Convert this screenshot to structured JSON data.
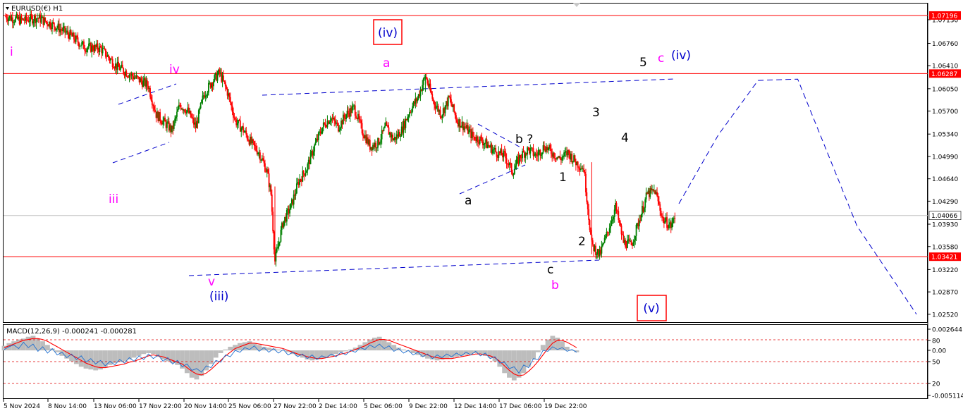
{
  "header": {
    "symbol_label": "EURUSD(€) H1"
  },
  "chart_data": {
    "type": "candlestick",
    "symbol": "EURUSD(€)",
    "timeframe": "H1",
    "y_ticks": [
      "1.07130",
      "1.06760",
      "1.06410",
      "1.06050",
      "1.05700",
      "1.05340",
      "1.04990",
      "1.04640",
      "1.04290",
      "1.03930",
      "1.03580",
      "1.03220",
      "1.02870",
      "1.02520"
    ],
    "x_ticks": [
      "5 Nov 2024",
      "8 Nov 14:00",
      "13 Nov 06:00",
      "17 Nov 22:00",
      "20 Nov 14:00",
      "25 Nov 06:00",
      "27 Nov 22:00",
      "2 Dec 14:00",
      "5 Dec 06:00",
      "9 Dec 22:00",
      "12 Dec 14:00",
      "17 Dec 06:00",
      "19 Dec 22:00"
    ],
    "ylim": [
      1.0243,
      1.0735
    ],
    "horizontal_levels": [
      {
        "value": 1.07196,
        "label": "1.07196",
        "color": "#ff0000"
      },
      {
        "value": 1.06287,
        "label": "1.06287",
        "color": "#ff0000"
      },
      {
        "value": 1.03421,
        "label": "1.03421",
        "color": "#ff0000"
      },
      {
        "value": 1.04066,
        "label": "1.04066",
        "color": "#c0c0c0",
        "current_price": true
      }
    ],
    "wave_labels": {
      "magenta": [
        "i",
        "iii",
        "iv",
        "v",
        "a",
        "b",
        "c"
      ],
      "black": [
        "1",
        "2",
        "3",
        "4",
        "5",
        "a",
        "b ?",
        "c"
      ],
      "blue": [
        "(iii)",
        "(iv)"
      ],
      "boxed": [
        "(iv)",
        "(v)"
      ]
    },
    "price_path": [
      [
        0,
        1.0718
      ],
      [
        4,
        1.0712
      ],
      [
        8,
        1.0716
      ],
      [
        12,
        1.0705
      ],
      [
        16,
        1.069
      ],
      [
        20,
        1.067
      ],
      [
        24,
        1.0668
      ],
      [
        28,
        1.064
      ],
      [
        32,
        1.0625
      ],
      [
        36,
        1.061
      ],
      [
        38,
        1.0565
      ],
      [
        42,
        1.054
      ],
      [
        44,
        1.058
      ],
      [
        46,
        1.057
      ],
      [
        48,
        1.0545
      ],
      [
        50,
        1.0595
      ],
      [
        52,
        1.0615
      ],
      [
        54,
        1.063
      ],
      [
        56,
        1.06
      ],
      [
        58,
        1.0555
      ],
      [
        60,
        1.054
      ],
      [
        62,
        1.052
      ],
      [
        64,
        1.0505
      ],
      [
        66,
        1.0475
      ],
      [
        67,
        1.044
      ],
      [
        68,
        1.0335
      ],
      [
        70,
        1.0395
      ],
      [
        72,
        1.042
      ],
      [
        74,
        1.046
      ],
      [
        76,
        1.048
      ],
      [
        78,
        1.0515
      ],
      [
        80,
        1.0545
      ],
      [
        82,
        1.056
      ],
      [
        84,
        1.0545
      ],
      [
        86,
        1.0565
      ],
      [
        88,
        1.0575
      ],
      [
        90,
        1.054
      ],
      [
        92,
        1.0515
      ],
      [
        94,
        1.052
      ],
      [
        96,
        1.0545
      ],
      [
        98,
        1.0525
      ],
      [
        100,
        1.054
      ],
      [
        102,
        1.057
      ],
      [
        104,
        1.059
      ],
      [
        106,
        1.0625
      ],
      [
        108,
        1.0585
      ],
      [
        110,
        1.0565
      ],
      [
        112,
        1.059
      ],
      [
        114,
        1.0555
      ],
      [
        116,
        1.0545
      ],
      [
        118,
        1.053
      ],
      [
        120,
        1.0525
      ],
      [
        122,
        1.0515
      ],
      [
        124,
        1.0505
      ],
      [
        126,
        1.05
      ],
      [
        128,
        1.0475
      ],
      [
        130,
        1.05
      ],
      [
        132,
        1.051
      ],
      [
        134,
        1.05
      ],
      [
        136,
        1.0515
      ],
      [
        138,
        1.0505
      ],
      [
        140,
        1.0495
      ],
      [
        142,
        1.0505
      ],
      [
        144,
        1.049
      ],
      [
        146,
        1.048
      ],
      [
        148,
        1.036
      ],
      [
        150,
        1.0345
      ],
      [
        152,
        1.038
      ],
      [
        154,
        1.042
      ],
      [
        156,
        1.0365
      ],
      [
        158,
        1.036
      ],
      [
        160,
        1.04
      ],
      [
        162,
        1.044
      ],
      [
        164,
        1.0445
      ],
      [
        166,
        1.04
      ],
      [
        168,
        1.039
      ],
      [
        169,
        1.0405
      ]
    ],
    "projection": [
      [
        170,
        1.0425
      ],
      [
        180,
        1.0533
      ],
      [
        190,
        1.0618
      ],
      [
        200,
        1.062
      ],
      [
        215,
        1.039
      ],
      [
        230,
        1.0252
      ]
    ],
    "macd": {
      "label": "MACD(12,26,9) -0.000241 -0.000281",
      "y_ticks": [
        "0.002644",
        "80",
        "0.00",
        "50",
        "20",
        "-0.005114"
      ],
      "histogram": [
        0.0005,
        0.0008,
        0.001,
        0.0012,
        0.0013,
        0.0015,
        0.0016,
        0.0013,
        0.001,
        0.0006,
        0.0002,
        -0.0002,
        -0.0006,
        -0.0009,
        -0.0012,
        -0.0015,
        -0.0018,
        -0.002,
        -0.0021,
        -0.0022,
        -0.0021,
        -0.0019,
        -0.0016,
        -0.0014,
        -0.0013,
        -0.0012,
        -0.001,
        -0.0008,
        -0.0006,
        -0.0004,
        -0.0003,
        -0.0004,
        -0.0007,
        -0.001,
        -0.0012,
        -0.0014,
        -0.0016,
        -0.002,
        -0.0025,
        -0.003,
        -0.0032,
        -0.0028,
        -0.0022,
        -0.0015,
        -0.0008,
        -0.0003,
        0.0001,
        0.0004,
        0.0006,
        0.0008,
        0.0009,
        0.001,
        0.0008,
        0.0006,
        0.0004,
        0.0003,
        0.0002,
        0.0001,
        0.0,
        -0.0002,
        -0.0004,
        -0.0006,
        -0.0008,
        -0.001,
        -0.0011,
        -0.001,
        -0.0009,
        -0.0008,
        -0.0006,
        -0.0004,
        -0.0002,
        -0.0001,
        0.0001,
        0.0003,
        0.0006,
        0.0009,
        0.0012,
        0.0014,
        0.0015,
        0.0012,
        0.0009,
        0.0006,
        0.0003,
        0.0001,
        -0.0001,
        -0.0003,
        -0.0005,
        -0.0007,
        -0.0009,
        -0.001,
        -0.0011,
        -0.001,
        -0.0009,
        -0.0008,
        -0.0007,
        -0.0006,
        -0.0005,
        -0.0004,
        -0.0003,
        -0.0004,
        -0.0006,
        -0.0008,
        -0.0012,
        -0.0018,
        -0.0025,
        -0.003,
        -0.0033,
        -0.003,
        -0.0025,
        -0.0018,
        -0.001,
        -0.0002,
        0.0006,
        0.0012,
        0.0016,
        0.0014,
        0.001,
        0.0004,
        0.0,
        -0.0002
      ],
      "signal": [
        0.0003,
        0.0005,
        0.0007,
        0.0009,
        0.0011,
        0.0012,
        0.0013,
        0.0013,
        0.0012,
        0.001,
        0.0007,
        0.0004,
        0.0001,
        -0.0002,
        -0.0005,
        -0.0008,
        -0.0011,
        -0.0014,
        -0.0016,
        -0.0018,
        -0.0019,
        -0.0019,
        -0.0018,
        -0.0017,
        -0.0016,
        -0.0015,
        -0.0013,
        -0.0012,
        -0.001,
        -0.0008,
        -0.0006,
        -0.0005,
        -0.0006,
        -0.0007,
        -0.0009,
        -0.0011,
        -0.0013,
        -0.0015,
        -0.0019,
        -0.0023,
        -0.0026,
        -0.0027,
        -0.0025,
        -0.0021,
        -0.0016,
        -0.0011,
        -0.0006,
        -0.0002,
        0.0002,
        0.0004,
        0.0006,
        0.0008,
        0.0008,
        0.0007,
        0.0006,
        0.0005,
        0.0004,
        0.0003,
        0.0002,
        0.0,
        -0.0002,
        -0.0004,
        -0.0005,
        -0.0007,
        -0.0008,
        -0.0009,
        -0.0009,
        -0.0008,
        -0.0007,
        -0.0006,
        -0.0004,
        -0.0003,
        -0.0001,
        0.0001,
        0.0003,
        0.0005,
        0.0008,
        0.001,
        0.0012,
        0.0012,
        0.0011,
        0.0009,
        0.0007,
        0.0005,
        0.0003,
        0.0001,
        -0.0001,
        -0.0003,
        -0.0005,
        -0.0007,
        -0.0008,
        -0.0009,
        -0.0009,
        -0.0009,
        -0.0008,
        -0.0007,
        -0.0006,
        -0.0005,
        -0.0004,
        -0.0004,
        -0.0005,
        -0.0006,
        -0.0008,
        -0.0012,
        -0.0017,
        -0.0022,
        -0.0026,
        -0.0028,
        -0.0027,
        -0.0023,
        -0.0018,
        -0.0012,
        -0.0005,
        0.0002,
        0.0008,
        0.0011,
        0.0011,
        0.0009,
        0.0006,
        0.0003
      ],
      "main": [
        0.0001,
        0.0004,
        0.0006,
        0.0002,
        0.0009,
        0.0003,
        0.0007,
        -0.0001,
        0.0004,
        -0.0003,
        0.0002,
        -0.0005,
        -0.0002,
        -0.0008,
        -0.0004,
        -0.001,
        -0.0006,
        -0.0013,
        -0.0009,
        -0.0015,
        -0.0011,
        -0.0017,
        -0.0012,
        -0.0016,
        -0.001,
        -0.0014,
        -0.0008,
        -0.0012,
        -0.0006,
        -0.001,
        -0.0004,
        -0.0009,
        -0.0005,
        -0.0012,
        -0.0008,
        -0.0015,
        -0.0011,
        -0.0018,
        -0.0015,
        -0.0022,
        -0.002,
        -0.0024,
        -0.0017,
        -0.0019,
        -0.0011,
        -0.0013,
        -0.0005,
        -0.0007,
        0.0,
        -0.0002,
        0.0003,
        0.0001,
        0.0005,
        -0.0001,
        0.0003,
        -0.0002,
        0.0002,
        -0.0003,
        0.0001,
        -0.0005,
        -0.0002,
        -0.0007,
        -0.0004,
        -0.0009,
        -0.0005,
        -0.001,
        -0.0006,
        -0.0008,
        -0.0004,
        -0.0007,
        -0.0002,
        -0.0005,
        0.0,
        -0.0002,
        0.0003,
        0.0001,
        0.0006,
        0.0003,
        0.0007,
        0.0002,
        0.0005,
        -0.0001,
        0.0002,
        -0.0003,
        0.0,
        -0.0005,
        -0.0002,
        -0.0007,
        -0.0004,
        -0.0009,
        -0.0005,
        -0.0008,
        -0.0004,
        -0.0007,
        -0.0003,
        -0.0006,
        -0.0002,
        -0.0005,
        -0.0001,
        -0.0006,
        -0.0003,
        -0.0009,
        -0.0007,
        -0.0014,
        -0.0013,
        -0.002,
        -0.0018,
        -0.0025,
        -0.0016,
        -0.0019,
        -0.0009,
        -0.001,
        0.0,
        -0.0001,
        0.0004,
        0.0001,
        0.0003,
        -0.0001,
        0.0001,
        -0.0002
      ]
    }
  }
}
